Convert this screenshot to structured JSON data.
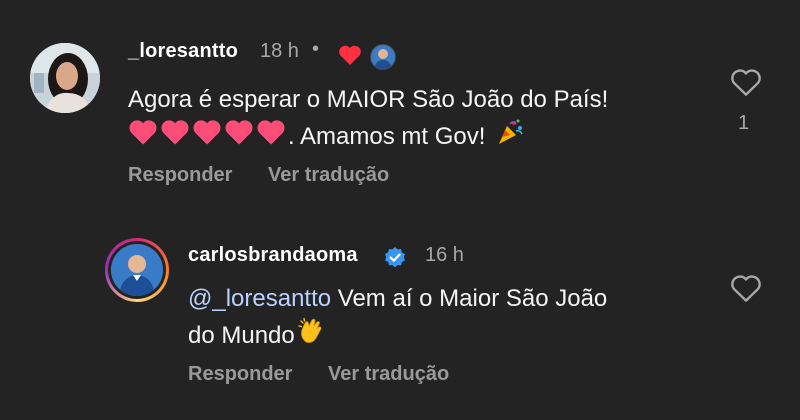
{
  "comments": [
    {
      "username": "_loresantto",
      "time": "18 h",
      "dot": "•",
      "text_line1": "Agora é esperar o MAIOR São João do País!",
      "text_line2_suffix": ". Amamos mt Gov!",
      "like_count": "1",
      "reply_label": "Responder",
      "translate_label": "Ver tradução",
      "hearts_color": "#ff3c6e",
      "liked_heart_color": "#ff3040"
    },
    {
      "username": "carlosbrandaoma",
      "time": "16 h",
      "mention": "@_loresantto",
      "text_line1": " Vem aí o Maior São João",
      "text_line2": "do Mundo",
      "reply_label": "Responder",
      "translate_label": "Ver tradução",
      "verified_color": "#3897f0"
    }
  ],
  "icons": {
    "like": "heart-outline-icon",
    "liked": "heart-filled-icon",
    "party": "party-popper-emoji",
    "clap": "clapping-hands-emoji",
    "verified": "verified-badge-icon"
  }
}
